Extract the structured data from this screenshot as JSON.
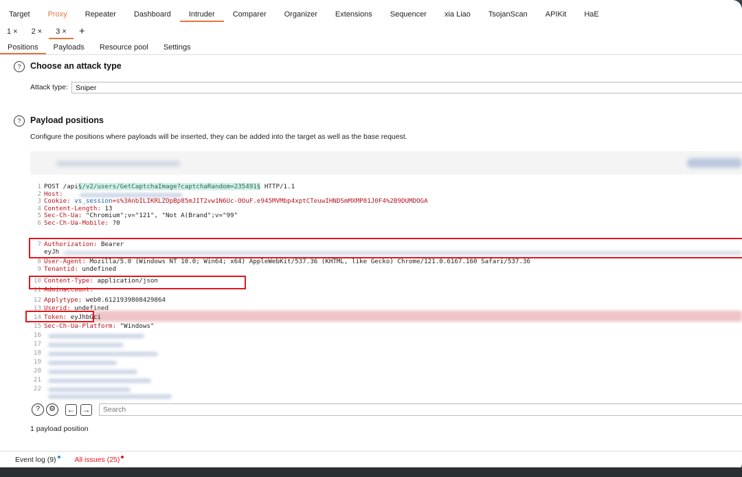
{
  "top_tabs": [
    "Target",
    "Proxy",
    "Repeater",
    "Dashboard",
    "Intruder",
    "Comparer",
    "Organizer",
    "Extensions",
    "Sequencer",
    "xia Liao",
    "TsojanScan",
    "APIKit",
    "HaE"
  ],
  "active_top_tab": "Intruder",
  "sub_tabs": [
    {
      "label": "1 ×"
    },
    {
      "label": "2 ×"
    },
    {
      "label": "3 ×"
    }
  ],
  "add_tab": "+",
  "intruder_tabs": [
    "Positions",
    "Payloads",
    "Resource pool",
    "Settings"
  ],
  "attack": {
    "help": "?",
    "title": "Choose an attack type",
    "label": "Attack type:",
    "value": "Sniper"
  },
  "positions": {
    "help": "?",
    "title": "Payload positions",
    "description": "Configure the positions where payloads will be inserted, they can be added into the target as well as the base request."
  },
  "request": {
    "l1_num": "1",
    "l1_pre": "POST /api",
    "l1_sect_open": "§",
    "l1_path": "/v2/users/GetCaptchaImage?captchaRandom=235491",
    "l1_sect_close": "§",
    "l1_post": " HTTP/1.1",
    "l2_num": "2",
    "l2_key": "Host:",
    "l3_num": "3",
    "l3_key": "Cookie:",
    "l3_a": " vs_session",
    "l3_b": "=s%3AnbILIKRLZOpBp85mJIT2vw1N6Uc-OOuF.e945MVMbp4xptCTeuwIHNDSmMXMP81J0F4%2B9DUMDOGA",
    "l4_num": "4",
    "l4_key": "Content-Length:",
    "l4_val": " 13",
    "l5_num": "5",
    "l5_key": "Sec-Ch-Ua:",
    "l5_val": " \"Chromium\";v=\"121\", \"Not A(Brand\";v=\"99\"",
    "l6_num": "6",
    "l6_key": "Sec-Ch-Ua-Mobile:",
    "l6_val": " ?0",
    "l7_num": "7",
    "l7_key": "Authorization:",
    "l7_val": " Bearer",
    "l7b": "eyJh",
    "l8_num": "8",
    "l8_key": "User-Agent:",
    "l8_val": " Mozilla/5.0 (Windows NT 10.0; Win64; x64) AppleWebKit/537.36 (KHTML, like Gecko) Chrome/121.0.6167.160 Safari/537.36",
    "l9_num": "9",
    "l9_key": "Tenantid:",
    "l9_val": " undefined",
    "l10_num": "10",
    "l10_key": "Content-Type:",
    "l10_val": " application/json",
    "l11_num": "11",
    "l11_key": "Adminaccount:",
    "l12_num": "12",
    "l12_key": "Applytype:",
    "l12_val": " web0.6121939808429864",
    "l13_num": "13",
    "l13_key": "Userid:",
    "l13_val": " undefined",
    "l14_num": "14",
    "l14_key": "Token:",
    "l14_val": " eyJhbGci",
    "l15_num": "15",
    "l15_key": "Sec-Ch-Ua-Platform:",
    "l15_val": " \"Windows\"",
    "empty_nums": [
      "16",
      "17",
      "18",
      "19",
      "20",
      "21",
      "22"
    ]
  },
  "search": {
    "placeholder": "Search",
    "help": "?",
    "settings": "⚙",
    "back": "←",
    "forward": "→"
  },
  "payload_count": "1 payload position",
  "status": {
    "event_log": "Event log (9)",
    "issues": "All issues (25)"
  },
  "colors": {
    "accent": "#e8743b",
    "highlight_box": "#e2151b",
    "header_key": "#b5121b",
    "marker_bg": "#d6efe9"
  }
}
